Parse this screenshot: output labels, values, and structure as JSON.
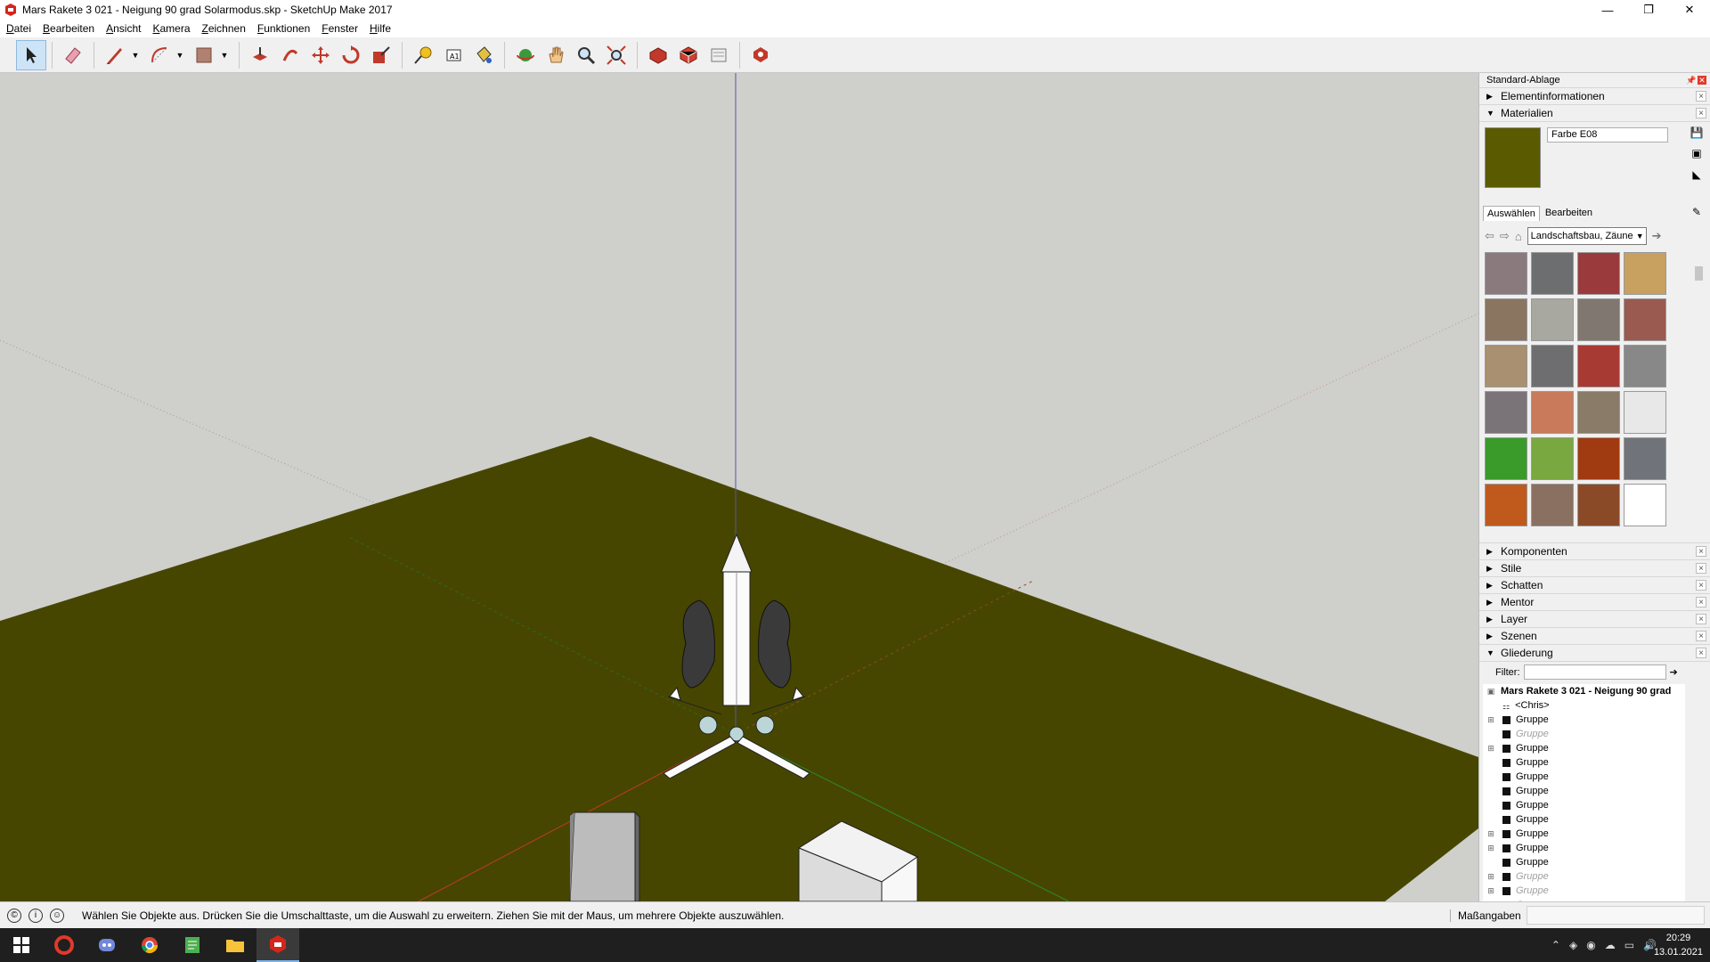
{
  "window": {
    "title": "Mars Rakete 3 021 - Neigung 90 grad Solarmodus.skp - SketchUp Make 2017",
    "minimize": "—",
    "maximize": "❐",
    "close": "✕"
  },
  "menu": [
    "Datei",
    "Bearbeiten",
    "Ansicht",
    "Kamera",
    "Zeichnen",
    "Funktionen",
    "Fenster",
    "Hilfe"
  ],
  "toolbar": {
    "tools": [
      "select-tool",
      "eraser-tool",
      "line-tool",
      "arc-tool",
      "rectangle-tool",
      "push-pull-tool",
      "offset-tool",
      "move-tool",
      "rotate-tool",
      "scale-tool",
      "tape-measure-tool",
      "text-tool",
      "paint-bucket-tool",
      "orbit-tool",
      "pan-tool",
      "zoom-tool",
      "zoom-extents-tool",
      "3d-warehouse",
      "extension-warehouse",
      "layout-tool",
      "extension-manager"
    ]
  },
  "tray": {
    "title": "Standard-Ablage",
    "panels_top": [
      {
        "label": "Elementinformationen",
        "expanded": false
      },
      {
        "label": "Materialien",
        "expanded": true
      }
    ],
    "materials": {
      "current_name": "Farbe E08",
      "current_color": "#5a5a00",
      "tabs": [
        "Auswählen",
        "Bearbeiten"
      ],
      "collection": "Landschaftsbau, Zäune",
      "swatches": [
        "#8a7a7e",
        "#6c6e70",
        "#9a3a3c",
        "#c8a060",
        "#8a7560",
        "#a8a8a0",
        "#807870",
        "#9a5a50",
        "#a89070",
        "#6e6e70",
        "#a83a34",
        "#888888",
        "#7a7478",
        "#c87a5a",
        "#8a7a68",
        "#e8e8e8",
        "#3a9a2a",
        "#7aa840",
        "#a03a10",
        "#70747a",
        "#c05a1c",
        "#8a7060",
        "#8a4a28",
        "#ffffff"
      ]
    },
    "panels_bottom": [
      {
        "label": "Komponenten",
        "expanded": false
      },
      {
        "label": "Stile",
        "expanded": false
      },
      {
        "label": "Schatten",
        "expanded": false
      },
      {
        "label": "Mentor",
        "expanded": false
      },
      {
        "label": "Layer",
        "expanded": false
      },
      {
        "label": "Szenen",
        "expanded": false
      },
      {
        "label": "Gliederung",
        "expanded": true
      }
    ],
    "outliner": {
      "filter_label": "Filter:",
      "root": "Mars Rakete 3 021 - Neigung 90 grad",
      "items": [
        {
          "label": "<Chris>",
          "expandable": false,
          "hidden": false,
          "component": true
        },
        {
          "label": "Gruppe",
          "expandable": true,
          "hidden": false
        },
        {
          "label": "Gruppe",
          "expandable": false,
          "hidden": true
        },
        {
          "label": "Gruppe",
          "expandable": true,
          "hidden": false
        },
        {
          "label": "Gruppe",
          "expandable": false,
          "hidden": false
        },
        {
          "label": "Gruppe",
          "expandable": false,
          "hidden": false
        },
        {
          "label": "Gruppe",
          "expandable": false,
          "hidden": false
        },
        {
          "label": "Gruppe",
          "expandable": false,
          "hidden": false
        },
        {
          "label": "Gruppe",
          "expandable": false,
          "hidden": false
        },
        {
          "label": "Gruppe",
          "expandable": true,
          "hidden": false
        },
        {
          "label": "Gruppe",
          "expandable": true,
          "hidden": false
        },
        {
          "label": "Gruppe",
          "expandable": false,
          "hidden": false
        },
        {
          "label": "Gruppe",
          "expandable": true,
          "hidden": true
        },
        {
          "label": "Gruppe",
          "expandable": true,
          "hidden": true
        },
        {
          "label": "Gruppe",
          "expandable": true,
          "hidden": true
        },
        {
          "label": "Gruppe",
          "expandable": true,
          "hidden": true
        }
      ]
    }
  },
  "status": {
    "hint": "Wählen Sie Objekte aus. Drücken Sie die Umschalttaste, um die Auswahl zu erweitern. Ziehen Sie mit der Maus, um mehrere Objekte auszuwählen.",
    "measure_label": "Maßangaben",
    "measure_value": ""
  },
  "taskbar": {
    "apps": [
      "start-button",
      "opera",
      "discord",
      "chrome",
      "notepad",
      "file-explorer",
      "sketchup"
    ],
    "time": "20:29",
    "date": "13.01.2021"
  },
  "colors": {
    "ground": "#474600",
    "sky": "#cfcfcc",
    "axis_red": "#c0392b",
    "axis_green": "#2a8a2a",
    "axis_blue": "#3a3aa8"
  }
}
